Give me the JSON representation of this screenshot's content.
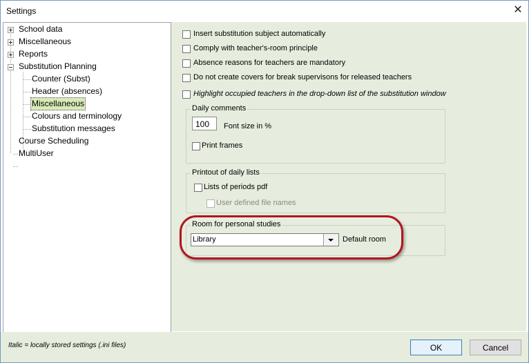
{
  "window": {
    "title": "Settings",
    "close_icon": "close-icon"
  },
  "tree": {
    "items": [
      {
        "label": "School data"
      },
      {
        "label": "Miscellaneous"
      },
      {
        "label": "Reports"
      },
      {
        "label": "Substitution Planning"
      },
      {
        "label": "Counter (Subst)"
      },
      {
        "label": "Header (absences)"
      },
      {
        "label": "Miscellaneous",
        "selected": true
      },
      {
        "label": "Colours and terminology"
      },
      {
        "label": "Substitution messages"
      },
      {
        "label": "Course Scheduling"
      },
      {
        "label": "MultiUser"
      }
    ]
  },
  "options": {
    "insert_subject": "Insert substitution subject automatically",
    "comply_room": "Comply with teacher's-room principle",
    "absence_reasons": "Absence reasons for teachers are mandatory",
    "no_covers": "Do not create covers for break supervisons for released teachers",
    "highlight_teachers": "Highlight occupied teachers in the drop-down list of the substitution window"
  },
  "daily_comments": {
    "title": "Daily comments",
    "font_size_value": "100",
    "font_size_label": "Font size in %",
    "print_frames": "Print frames"
  },
  "printout": {
    "title": "Printout of daily lists",
    "lists_pdf": "Lists of periods pdf",
    "user_defined": "User defined file names"
  },
  "room": {
    "title": "Room for personal studies",
    "selected": "Library",
    "default_label": "Default room"
  },
  "footer": {
    "note": "Italic = locally stored settings (.ini files)",
    "ok": "OK",
    "cancel": "Cancel"
  },
  "colors": {
    "selected_bg": "#d7ecb5",
    "panel_bg": "#e6edde",
    "highlight": "#b3141c"
  }
}
